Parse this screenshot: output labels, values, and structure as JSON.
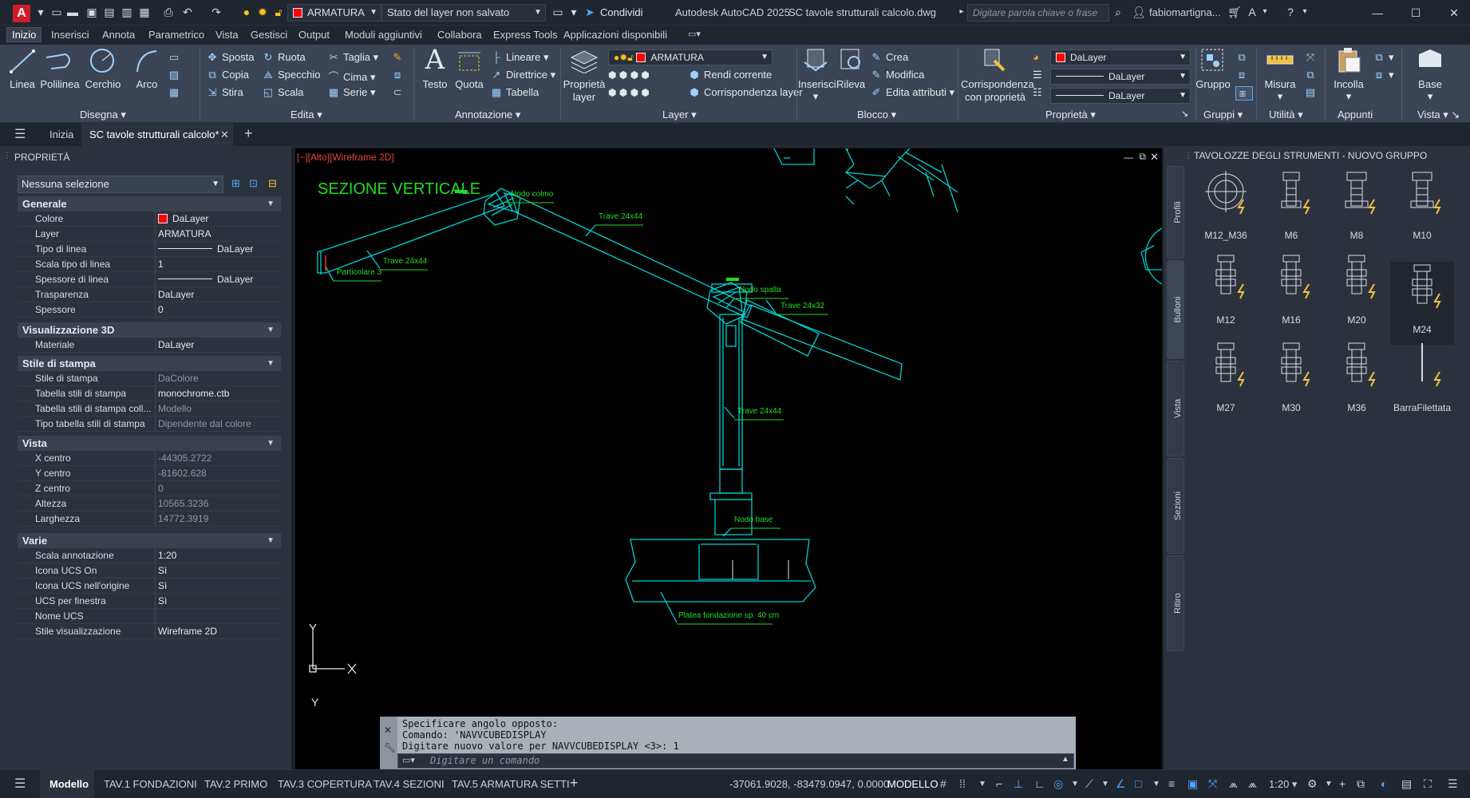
{
  "titlebar": {
    "layer_name": "ARMATURA",
    "layer_state": "Stato del layer non salvato",
    "share_label": "Condividi",
    "app_title": "Autodesk AutoCAD 2025",
    "file_title": "SC tavole strutturali calcolo.dwg",
    "search_placeholder": "Digitare parola chiave o frase",
    "user": "fabiomartigna..."
  },
  "ribbon_tabs": [
    "Inizio",
    "Inserisci",
    "Annota",
    "Parametrico",
    "Vista",
    "Gestisci",
    "Output",
    "Moduli aggiuntivi",
    "Collabora",
    "Express Tools",
    "Applicazioni disponibili"
  ],
  "ribbon": {
    "disegna": {
      "linea": "Linea",
      "polilinea": "Polilinea",
      "cerchio": "Cerchio",
      "arco": "Arco",
      "group": "Disegna"
    },
    "edita": {
      "sposta": "Sposta",
      "ruota": "Ruota",
      "taglia": "Taglia",
      "copia": "Copia",
      "specchio": "Specchio",
      "cima": "Cima",
      "stira": "Stira",
      "scala": "Scala",
      "serie": "Serie",
      "group": "Edita"
    },
    "annotazione": {
      "testo": "Testo",
      "quota": "Quota",
      "lineare": "Lineare",
      "direttrice": "Direttrice",
      "tabella": "Tabella",
      "group": "Annotazione"
    },
    "layer": {
      "proprieta": "Proprietà",
      "proprieta2": "layer",
      "current_layer": "ARMATURA",
      "rendi_corrente": "Rendi corrente",
      "corrispondenza": "Corrispondenza layer",
      "group": "Layer"
    },
    "blocco": {
      "inserisci": "Inserisci",
      "rileva": "Rileva",
      "crea": "Crea",
      "modifica": "Modifica",
      "edita_attributi": "Edita attributi",
      "group": "Blocco"
    },
    "proprieta": {
      "corrispondenza": "Corrispondenza",
      "corrispondenza2": "con proprietà",
      "color": "DaLayer",
      "linetype": "DaLayer",
      "lineweight": "DaLayer",
      "group": "Proprietà"
    },
    "gruppi": {
      "gruppo": "Gruppo",
      "group": "Gruppi"
    },
    "utilita": {
      "misura": "Misura",
      "group": "Utilità"
    },
    "appunti": {
      "incolla": "Incolla",
      "group": "Appunti"
    },
    "vista": {
      "base": "Base",
      "group": "Vista"
    }
  },
  "filetabs": {
    "inizia": "Inizia",
    "current": "SC tavole strutturali calcolo*"
  },
  "properties": {
    "title": "PROPRIETÀ",
    "selection": "Nessuna selezione",
    "sections": {
      "generale": "Generale",
      "vis3d": "Visualizzazione 3D",
      "stile": "Stile di stampa",
      "vista": "Vista",
      "varie": "Varie"
    },
    "generale": [
      {
        "k": "Colore",
        "v": "DaLayer"
      },
      {
        "k": "Layer",
        "v": "ARMATURA"
      },
      {
        "k": "Tipo di linea",
        "v": "DaLayer"
      },
      {
        "k": "Scala tipo di linea",
        "v": "1"
      },
      {
        "k": "Spessore di linea",
        "v": "DaLayer"
      },
      {
        "k": "Trasparenza",
        "v": "DaLayer"
      },
      {
        "k": "Spessore",
        "v": "0"
      }
    ],
    "vis3d": [
      {
        "k": "Materiale",
        "v": "DaLayer"
      }
    ],
    "stile": [
      {
        "k": "Stile di stampa",
        "v": "DaColore"
      },
      {
        "k": "Tabella stili di stampa",
        "v": "monochrome.ctb"
      },
      {
        "k": "Tabella stili di stampa coll...",
        "v": "Modello"
      },
      {
        "k": "Tipo tabella stili di stampa",
        "v": "Dipendente dal colore"
      }
    ],
    "vista": [
      {
        "k": "X centro",
        "v": "-44305.2722"
      },
      {
        "k": "Y centro",
        "v": "-81602.628"
      },
      {
        "k": "Z centro",
        "v": "0"
      },
      {
        "k": "Altezza",
        "v": "10565.3236"
      },
      {
        "k": "Larghezza",
        "v": "14772.3919"
      }
    ],
    "varie": [
      {
        "k": "Scala annotazione",
        "v": "1:20"
      },
      {
        "k": "Icona UCS On",
        "v": "Sì"
      },
      {
        "k": "Icona UCS nell'origine",
        "v": "Sì"
      },
      {
        "k": "UCS per finestra",
        "v": "Sì"
      },
      {
        "k": "Nome UCS",
        "v": ""
      },
      {
        "k": "Stile visualizzazione",
        "v": "Wireframe 2D"
      }
    ]
  },
  "viewport": {
    "label": "[−][Alto][Wireframe 2D]",
    "title": "SEZIONE VERTICALE",
    "labels": {
      "nodo_colmo": "Nodo colmo",
      "trave1": "Trave 24x44",
      "trave2": "Trave 24x44",
      "particolare": "Particolare 3",
      "nodo_spalla": "Nodo spalla",
      "trave3": "Trave 24x32",
      "trave4": "Trave 24x44",
      "nodo_base": "Nodo base",
      "platea": "Platea fondazione sp. 40 cm"
    },
    "ucs_x": "X",
    "ucs_y": "Y"
  },
  "command": {
    "line1": "Specificare angolo opposto:",
    "line2": "Comando: 'NAVVCUBEDISPLAY",
    "line3": "Digitare nuovo valore per NAVVCUBEDISPLAY <3>: 1",
    "placeholder": "Digitare un comando"
  },
  "palette": {
    "title": "TAVOLOZZE DEGLI STRUMENTI - NUOVO GRUPPO",
    "vtabs": [
      "Profili",
      "Bulloni",
      "Vista",
      "Sezioni",
      "Ritiro"
    ],
    "tools": [
      "M12_M36",
      "M6",
      "M8",
      "M10",
      "M12",
      "M16",
      "M20",
      "M24",
      "M27",
      "M30",
      "M36",
      "BarraFilettata"
    ]
  },
  "status": {
    "tabs": [
      "Modello",
      "TAV.1 FONDAZIONI",
      "TAV.2 PRIMO",
      "TAV.3 COPERTURA",
      "TAV.4 SEZIONI",
      "TAV.5 ARMATURA SETTI"
    ],
    "coords": "-37061.9028, -83479.0947, 0.0000",
    "mode": "MODELLO",
    "scale": "1:20"
  },
  "colors": {
    "cad_line": "#00d2d2",
    "cad_label": "#22dd22",
    "accent": "#4fa8ff",
    "layer_red": "#ff0000"
  }
}
